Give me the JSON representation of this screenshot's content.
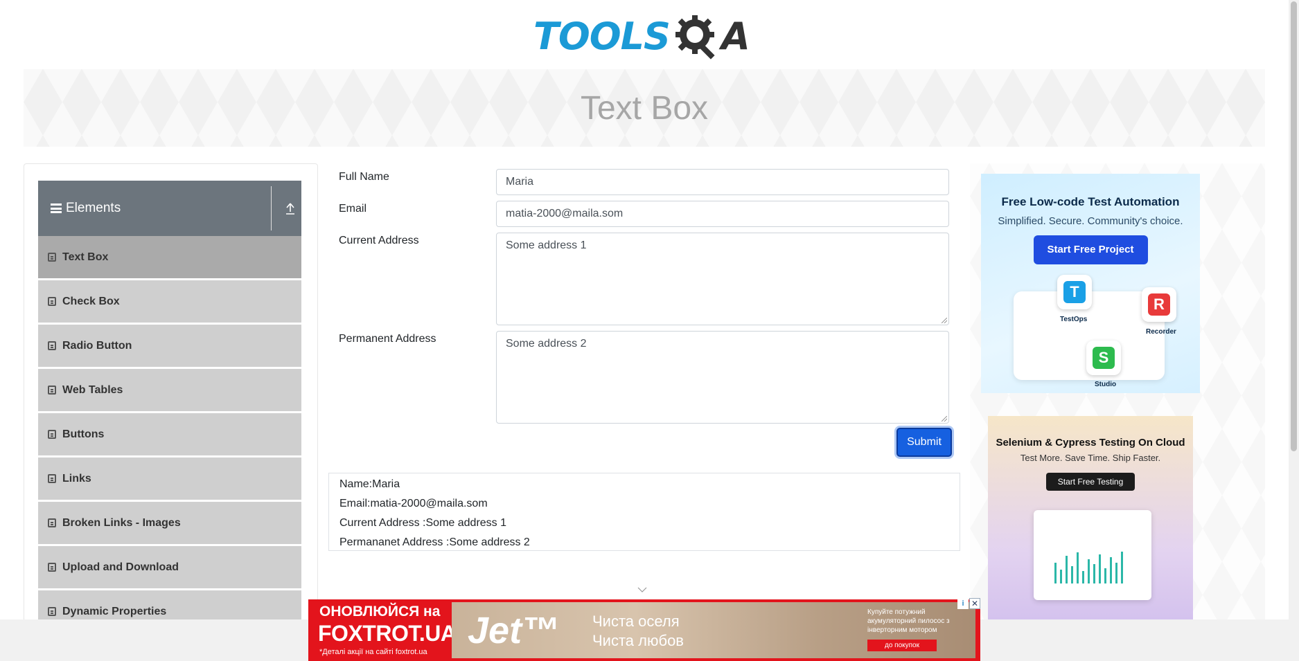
{
  "header": {
    "logo_text": "TOOLS",
    "logo_tail": "A"
  },
  "banner": {
    "title": "Text Box"
  },
  "sidebar": {
    "group_title": "Elements",
    "items": [
      {
        "label": "Text Box",
        "active": true
      },
      {
        "label": "Check Box"
      },
      {
        "label": "Radio Button"
      },
      {
        "label": "Web Tables"
      },
      {
        "label": "Buttons"
      },
      {
        "label": "Links"
      },
      {
        "label": "Broken Links - Images"
      },
      {
        "label": "Upload and Download"
      },
      {
        "label": "Dynamic Properties"
      }
    ]
  },
  "form": {
    "full_name_label": "Full Name",
    "full_name_value": "Maria",
    "email_label": "Email",
    "email_value": "matia-2000@maila.som",
    "current_address_label": "Current Address",
    "current_address_value": "Some address 1",
    "permanent_address_label": "Permanent Address",
    "permanent_address_value": "Some address 2",
    "submit_label": "Submit"
  },
  "output": {
    "name": "Name:Maria",
    "email": "Email:matia-2000@maila.som",
    "current_address": "Current Address :Some address 1",
    "permanent_address": "Permananet Address :Some address 2"
  },
  "ads": {
    "ad1": {
      "headline": "Free Low-code Test Automation",
      "sub": "Simplified. Secure. Community's choice.",
      "button": "Start Free Project",
      "tiles": [
        "TestOps",
        "Recorder",
        "Studio"
      ]
    },
    "ad2": {
      "headline": "Selenium & Cypress Testing On Cloud",
      "sub": "Test More. Save Time. Ship Faster.",
      "button": "Start Free Testing"
    },
    "bottom": {
      "line1": "ОНОВЛЮЙСЯ на",
      "line2": "FOXTROT.UA",
      "line3": "*Деталі акції на сайті foxtrot.ua",
      "brand": "Jet™",
      "slogan1": "Чиста оселя",
      "slogan2": "Чиста любов",
      "right_text": "Купуйте потужний акумуляторний пилосос з інверторним мотором",
      "buy": "до покупок"
    }
  },
  "colors": {
    "accent": "#1660e0",
    "sidebar_header": "#6c757d",
    "menu_item": "#cfcfcf",
    "menu_active": "#aaaaaa"
  }
}
